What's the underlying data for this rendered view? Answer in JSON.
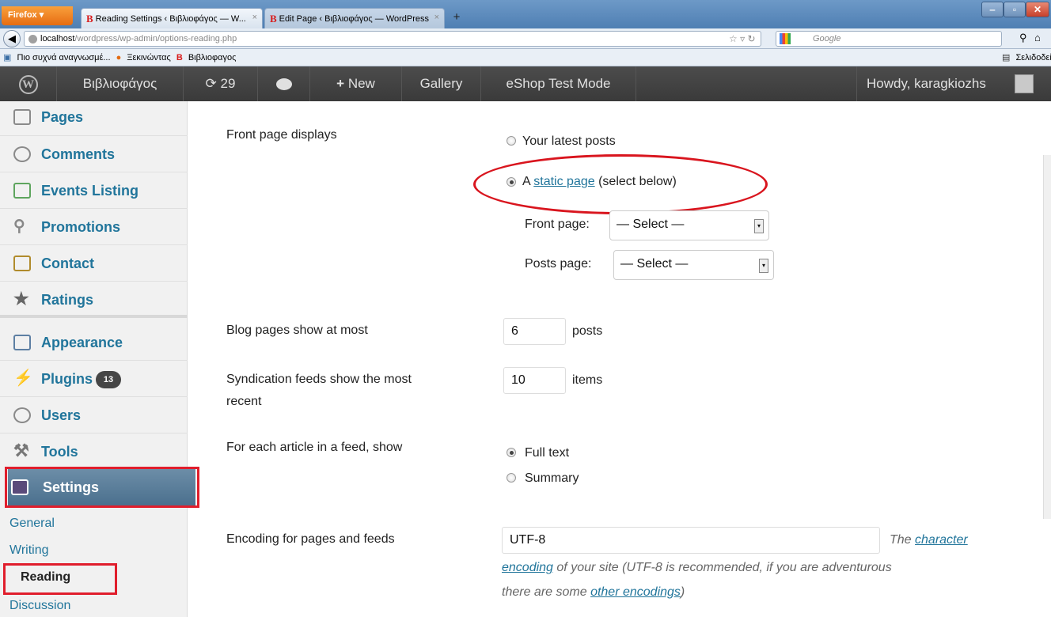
{
  "browser": {
    "menu_button": "Firefox ▾",
    "tabs": [
      {
        "label": "Reading Settings ‹ Βιβλιοφάγος — W...",
        "close": "×"
      },
      {
        "label": "Edit Page ‹ Βιβλιοφάγος — WordPress",
        "close": "×"
      }
    ],
    "new_tab": "+",
    "window_buttons": [
      "‒",
      "▫",
      "✕"
    ],
    "url_host": "localhost",
    "url_path": "/wordpress/wp-admin/options-reading.php",
    "search_placeholder": "Google",
    "bookmarks": [
      "Πιο συχνά αναγνωσμέ...",
      "Ξεκινώντας",
      "Βιβλιοφαγος"
    ],
    "bookmarks_right": "Σελιδοδείκτ",
    "icons": [
      "back-icon",
      "globe-icon",
      "star-icon",
      "reload-icon",
      "google-icon",
      "search-icon",
      "home-icon",
      "skype-icon"
    ]
  },
  "adminbar": {
    "site_name": "Βιβλιοφάγος",
    "updates_count": "29",
    "new_label": "New",
    "gallery": "Gallery",
    "eshop": "eShop Test Mode",
    "howdy": "Howdy, karagkiozhs"
  },
  "sidebar": {
    "items": [
      {
        "label": "Pages"
      },
      {
        "label": "Comments"
      },
      {
        "label": "Events Listing"
      },
      {
        "label": "Promotions"
      },
      {
        "label": "Contact"
      },
      {
        "label": "Ratings"
      },
      {
        "label": "Appearance"
      },
      {
        "label": "Plugins",
        "badge": "13"
      },
      {
        "label": "Users"
      },
      {
        "label": "Tools"
      },
      {
        "label": "Settings"
      }
    ],
    "submenu": [
      "General",
      "Writing",
      "Reading",
      "Discussion"
    ]
  },
  "content": {
    "front_page_label": "Front page displays",
    "latest_posts": "Your latest posts",
    "static_prefix": "A",
    "static_link": "static page",
    "static_suffix": "(select below)",
    "front_page_select_label": "Front page:",
    "posts_page_select_label": "Posts page:",
    "select_value": "— Select —",
    "blog_pages_label": "Blog pages show at most",
    "blog_pages_value": "6",
    "blog_pages_unit": "posts",
    "syndication_label_1": "Syndication feeds show the most",
    "syndication_label_2": "recent",
    "syndication_value": "10",
    "syndication_unit": "items",
    "feed_article_label": "For each article in a feed, show",
    "full_text": "Full text",
    "summary": "Summary",
    "encoding_label": "Encoding for pages and feeds",
    "encoding_value": "UTF-8",
    "help_1": "The",
    "help_link_1": "character",
    "help_link_2": "encoding",
    "help_2": "of your site (UTF-8 is recommended, if you are adventurous",
    "help_3": "there are some",
    "help_link_3": "other encodings",
    "help_4": ")"
  },
  "colors": {
    "annotation_red": "#e01e2c",
    "link": "#21759b",
    "adminbar": "#464646"
  }
}
